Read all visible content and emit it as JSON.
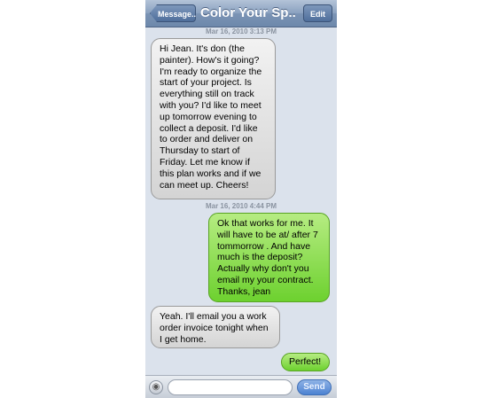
{
  "navbar": {
    "back_label": "Message...",
    "title": "Color Your Sp...",
    "edit_label": "Edit"
  },
  "timestamps": [
    "Mar 16, 2010 3:13 PM",
    "Mar 16, 2010 4:44 PM"
  ],
  "messages": [
    {
      "direction": "incoming",
      "text": "Hi Jean. It's don (the painter). How's it going? I'm ready to organize the start of your project. Is everything still on track with you? I'd like to meet up tomorrow evening to collect a deposit. I'd like to order and deliver on Thursday to start of Friday. Let me know if this plan works and if we can meet up. Cheers!"
    },
    {
      "direction": "outgoing",
      "text": "Ok that works for me. It will have to be at/ after 7 tommorrow . And have much is the deposit? Actually why don't you email my your contract. Thanks, jean"
    },
    {
      "direction": "incoming",
      "text": "Yeah. I'll email you a work order invoice tonight when I get home."
    },
    {
      "direction": "outgoing",
      "text": "Perfect!"
    }
  ],
  "compose": {
    "placeholder": "",
    "send_label": "Send"
  },
  "icons": {
    "camera": "camera-icon"
  },
  "colors": {
    "incoming_bubble": "#d9d9d9",
    "outgoing_bubble": "#86dc4a",
    "navbar": "#7b94b5",
    "background": "#dbe2ec"
  }
}
